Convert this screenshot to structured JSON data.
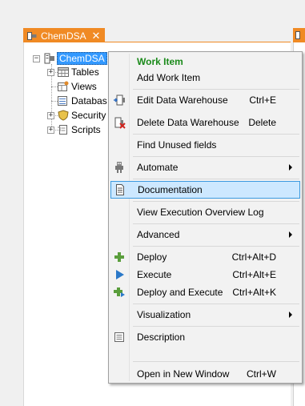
{
  "document_tab": {
    "title": "ChemDSA",
    "close": "✕",
    "icon": "database-model-icon"
  },
  "tree": {
    "root": {
      "label": "ChemDSA",
      "expander": "−",
      "icon": "database-model-icon"
    },
    "children": [
      {
        "label": "Tables",
        "expander": "+",
        "icon": "table-icon"
      },
      {
        "label": "Views",
        "expander": "",
        "icon": "view-icon"
      },
      {
        "label": "Databas",
        "expander": "",
        "icon": "database-icon"
      },
      {
        "label": "Security",
        "expander": "+",
        "icon": "shield-icon"
      },
      {
        "label": "Scripts",
        "expander": "+",
        "icon": "script-icon"
      }
    ]
  },
  "context_menu": {
    "header": "Work Item",
    "items": [
      {
        "label": "Add Work Item",
        "shortcut": "",
        "icon": ""
      },
      {
        "label": "Edit Data Warehouse",
        "shortcut": "Ctrl+E",
        "icon": "edit-warehouse-icon"
      },
      {
        "label": "Delete Data Warehouse",
        "shortcut": "Delete",
        "icon": "delete-warehouse-icon"
      },
      {
        "label": "Find Unused fields",
        "shortcut": "",
        "icon": ""
      },
      {
        "label": "Automate",
        "shortcut": "",
        "icon": "robot-icon",
        "submenu": true
      },
      {
        "label": "Documentation",
        "shortcut": "",
        "icon": "document-icon",
        "highlighted": true
      },
      {
        "label": "View Execution Overview Log",
        "shortcut": "",
        "icon": ""
      },
      {
        "label": "Advanced",
        "shortcut": "",
        "icon": "",
        "submenu": true
      },
      {
        "label": "Deploy",
        "shortcut": "Ctrl+Alt+D",
        "icon": "deploy-icon"
      },
      {
        "label": "Execute",
        "shortcut": "Ctrl+Alt+E",
        "icon": "play-icon"
      },
      {
        "label": "Deploy and Execute",
        "shortcut": "Ctrl+Alt+K",
        "icon": "deploy-execute-icon"
      },
      {
        "label": "Visualization",
        "shortcut": "",
        "icon": "",
        "submenu": true
      },
      {
        "label": "Description",
        "shortcut": "",
        "icon": "description-icon"
      },
      {
        "label": "Open in New Window",
        "shortcut": "Ctrl+W",
        "icon": ""
      }
    ]
  },
  "colors": {
    "tab_accent": "#f08a24",
    "selection": "#3399ff",
    "menu_highlight": "#cde8ff",
    "header_green": "#1a8a1a",
    "icon_green": "#5a9e3c",
    "play_blue": "#2a78c8"
  }
}
